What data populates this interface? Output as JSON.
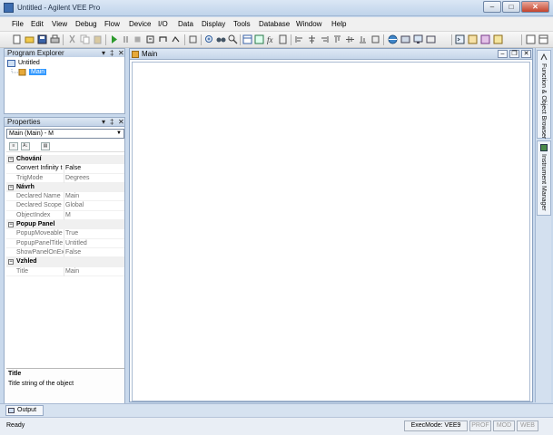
{
  "window": {
    "title": "Untitled - Agilent VEE Pro"
  },
  "menu": [
    "File",
    "Edit",
    "View",
    "Debug",
    "Flow",
    "Device",
    "I/O",
    "Data",
    "Display",
    "Tools",
    "Database",
    "Window",
    "Help"
  ],
  "explorer": {
    "title": "Program Explorer",
    "tree": {
      "root": "Untitled",
      "child": "Main"
    }
  },
  "properties": {
    "title": "Properties",
    "selector": "Main (Main) - M",
    "categories": [
      {
        "name": "Chování",
        "rows": [
          {
            "name": "Convert Infinity t",
            "value": "False",
            "active": true
          },
          {
            "name": "TrigMode",
            "value": "Degrees",
            "active": false
          }
        ]
      },
      {
        "name": "Návrh",
        "rows": [
          {
            "name": "Declared Name",
            "value": "Main",
            "active": false
          },
          {
            "name": "Declared Scope",
            "value": "Global",
            "active": false
          },
          {
            "name": "ObjectIndex",
            "value": "M",
            "active": false
          }
        ]
      },
      {
        "name": "Popup Panel",
        "rows": [
          {
            "name": "PopupMoveable",
            "value": "True",
            "active": false
          },
          {
            "name": "PopupPanelTitle",
            "value": "Untitled",
            "active": false
          },
          {
            "name": "ShowPanelOnEx",
            "value": "False",
            "active": false
          }
        ]
      },
      {
        "name": "Vzhled",
        "rows": [
          {
            "name": "Title",
            "value": "Main",
            "active": false
          }
        ]
      }
    ],
    "description": {
      "title": "Title",
      "text": "Title string of the object"
    }
  },
  "main_window": {
    "title": "Main"
  },
  "side_tabs": [
    "Function & Object Browser",
    "Instrument Manager"
  ],
  "output_tab": "Output",
  "status": {
    "text": "Ready",
    "exec_mode": "ExecMode: VEE9",
    "indicators": [
      "PROF",
      "MOD",
      "WEB"
    ]
  },
  "colors": {
    "accent": "#3399ff",
    "frame": "#c9d9ec"
  }
}
